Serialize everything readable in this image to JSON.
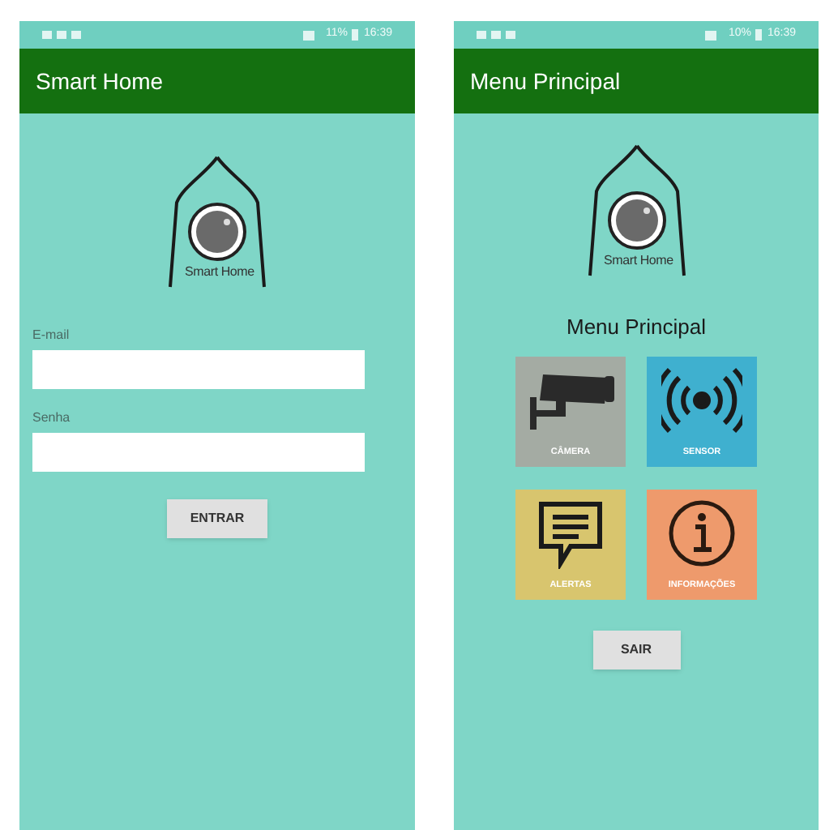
{
  "screens": [
    {
      "kind": "login",
      "status_bar": {
        "battery": "11%",
        "time": "16:39"
      },
      "app_bar": {
        "title": "Smart Home"
      },
      "logo_text": "Smart Home",
      "fields": [
        {
          "label": "E-mail"
        },
        {
          "label": "Senha"
        }
      ],
      "button": "ENTRAR"
    },
    {
      "kind": "menu",
      "status_bar": {
        "battery": "10%",
        "time": "16:39"
      },
      "app_bar": {
        "title": "Menu Principal"
      },
      "logo_text": "Smart Home",
      "heading": "Menu Principal",
      "tiles": [
        {
          "label": "CÂMERA",
          "kind": "camera",
          "color": "#a4aba3"
        },
        {
          "label": "SENSOR",
          "kind": "sensor",
          "color": "#3fb0cf"
        },
        {
          "label": "ALERTAS",
          "kind": "alert",
          "color": "#d8c56e"
        },
        {
          "label": "INFORMAÇÕES",
          "kind": "info",
          "color": "#ee9a6c"
        }
      ],
      "button": "SAIR"
    }
  ]
}
